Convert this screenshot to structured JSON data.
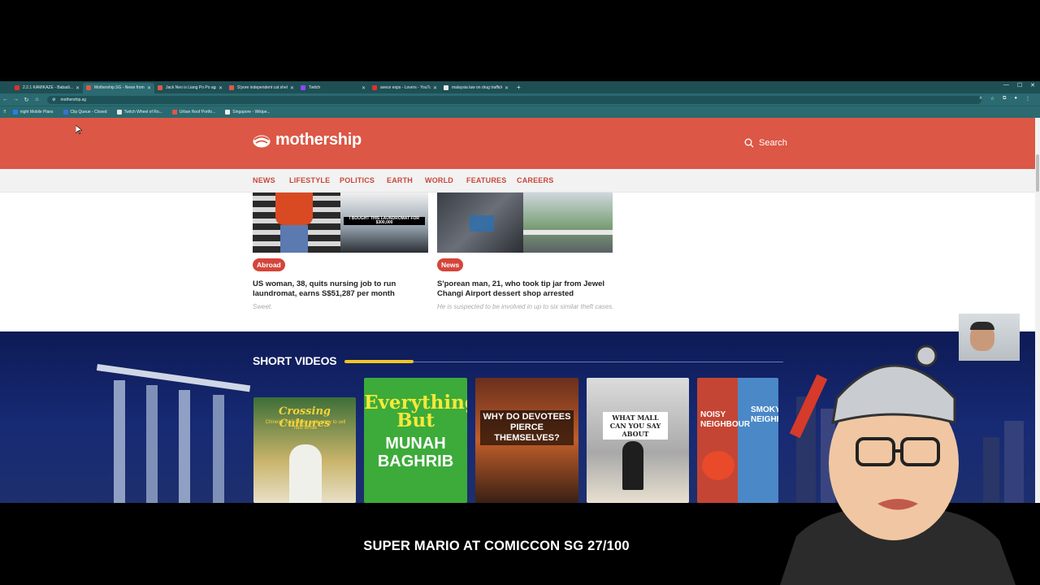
{
  "browser": {
    "tabs": [
      {
        "title": "2.2.1 KAMIKAZE - Babadi...",
        "favicon_color": "#e03030",
        "active": false
      },
      {
        "title": "Mothership.SG - News from Si...",
        "favicon_color": "#e0574a",
        "active": true
      },
      {
        "title": "Jack Neo is Liang Po Po again...",
        "favicon_color": "#e0574a",
        "active": false
      },
      {
        "title": "S'pore independent cat shelter...",
        "favicon_color": "#e0574a",
        "active": false
      },
      {
        "title": "Twitch",
        "favicon_color": "#9146ff",
        "active": false
      },
      {
        "title": "avece exps - Lovers - YouTube",
        "favicon_color": "#e03030",
        "active": false
      },
      {
        "title": "malaysia law on drug trafficking...",
        "favicon_color": "#e8e8e8",
        "active": false
      }
    ],
    "url": "mothership.sg",
    "bookmarks": [
      {
        "label": "night Mobile Plans",
        "favicon_color": "#2b7de9"
      },
      {
        "label": "Clip Queue - Closed",
        "favicon_color": "#3b6fd6"
      },
      {
        "label": "Twitch Wheel of Ro...",
        "favicon_color": "#e8e8e8"
      },
      {
        "label": "Urban Roof Portfo...",
        "favicon_color": "#e0574a"
      },
      {
        "label": "Singapore - Wikipe...",
        "favicon_color": "#f0f0f0"
      }
    ]
  },
  "site": {
    "logo_text": "mothership",
    "search_label": "Search",
    "brand_color": "#dc5745",
    "nav": [
      "NEWS",
      "LIFESTYLE",
      "POLITICS",
      "EARTH",
      "WORLD",
      "FEATURES",
      "CAREERS"
    ]
  },
  "articles": [
    {
      "tag": "Abroad",
      "headline": "US woman, 38, quits nursing job to run laundromat, earns S$51,287 per month",
      "dek": "Sweet.",
      "thumb_caption": "I BOUGHT THIS LAUNDROMAT FOR $300,000"
    },
    {
      "tag": "News",
      "headline": "S'porean man, 21, who took tip jar from Jewel Changi Airport dessert shop arrested",
      "dek": "He is suspected to be involved in up to six similar theft cases."
    }
  ],
  "short_videos": {
    "title": "SHORT VIDEOS",
    "accent_color": "#f2c523",
    "cards": [
      {
        "title": "Crossing Cultures",
        "subtitle": "Chinese SAF Major quits army to sell nasi lemak"
      },
      {
        "title": "Everything But",
        "title2": "MUNAH BAGHRIB"
      },
      {
        "title": "WHY DO DEVOTEES PIERCE THEMSELVES?"
      },
      {
        "title": "WHAT MALL CAN YOU SAY ABOUT"
      },
      {
        "title": "NOISY NEIGHBOUR",
        "title2": "SMOKY NEIGHB"
      }
    ]
  },
  "overlay": {
    "caption": "SUPER MARIO AT COMICCON SG 27/100"
  }
}
